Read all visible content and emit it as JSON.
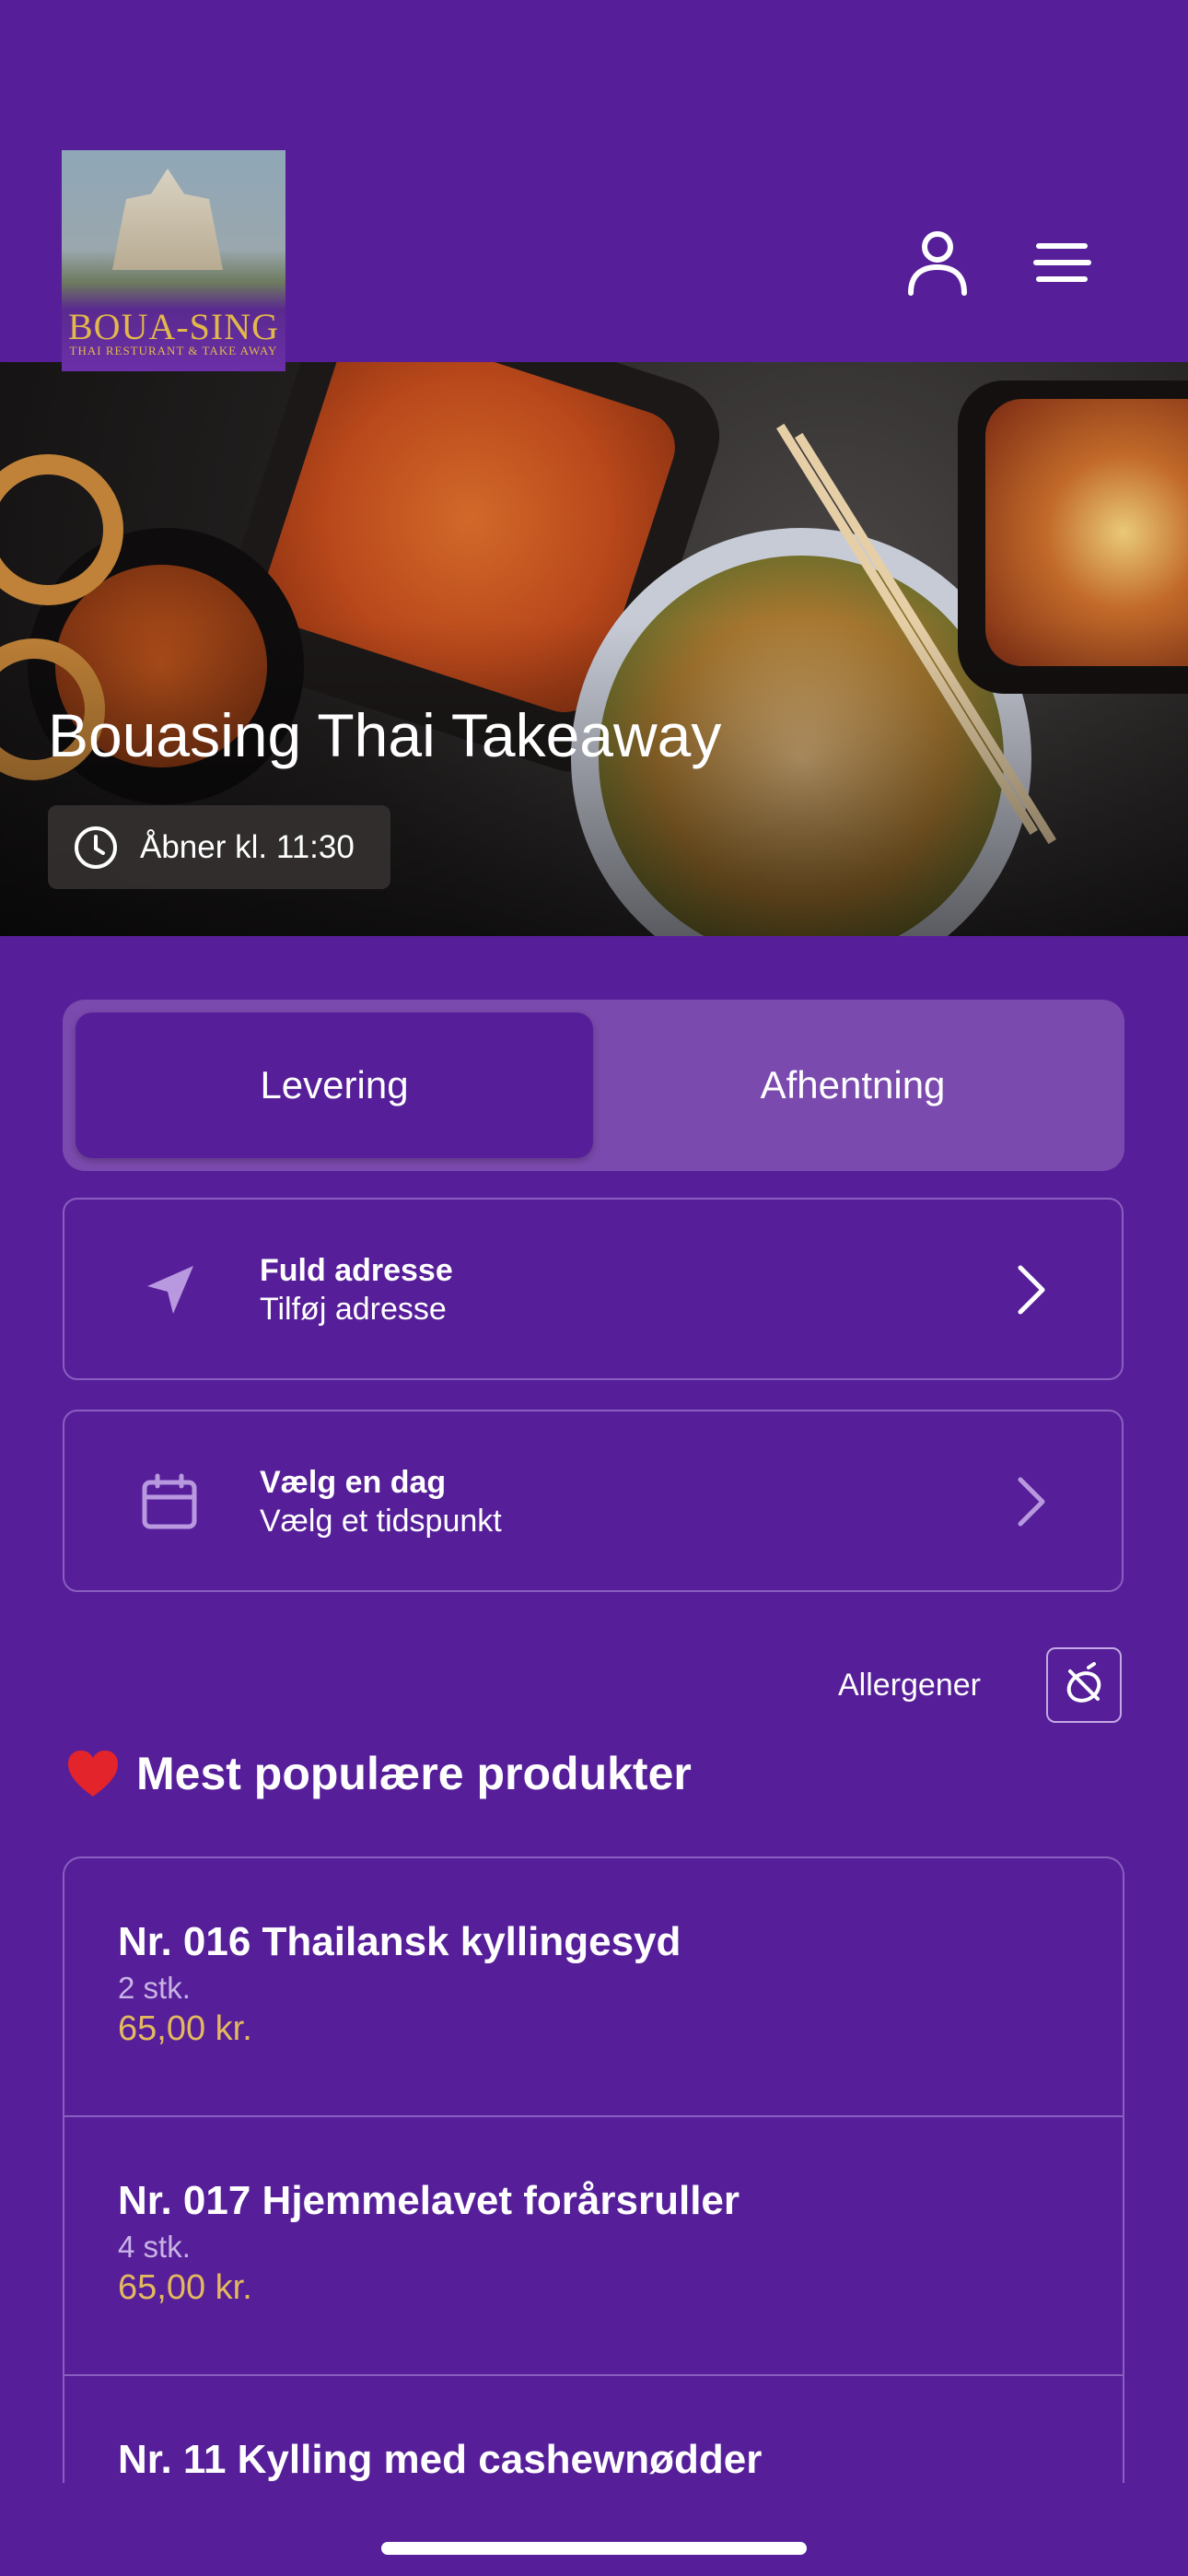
{
  "header": {
    "logo": {
      "name": "BOUA-SING",
      "subtitle": "THAI RESTURANT & TAKE AWAY"
    },
    "icons": [
      "user-icon",
      "menu-icon"
    ]
  },
  "hero": {
    "title": "Bouasing Thai Takeaway",
    "hours": "Åbner kl. 11:30"
  },
  "order_type": {
    "options": [
      "Levering",
      "Afhentning"
    ],
    "selected": "Levering"
  },
  "address_card": {
    "title": "Fuld adresse",
    "subtitle": "Tilføj adresse"
  },
  "time_card": {
    "title": "Vælg en dag",
    "subtitle": "Vælg et tidspunkt"
  },
  "allergens": {
    "label": "Allergener"
  },
  "popular": {
    "title": "Mest populære produkter",
    "products": [
      {
        "name": "Nr. 016 Thailansk kyllingesyd",
        "qty": "2 stk.",
        "price": "65,00 kr."
      },
      {
        "name": "Nr. 017 Hjemmelavet forårsruller",
        "qty": "4 stk.",
        "price": "65,00 kr."
      },
      {
        "name": "Nr. 11 Kylling med cashewnødder"
      }
    ]
  },
  "colors": {
    "background": "#561f99",
    "price": "#e4b95e",
    "toggle_bg": "#7b4aae"
  }
}
